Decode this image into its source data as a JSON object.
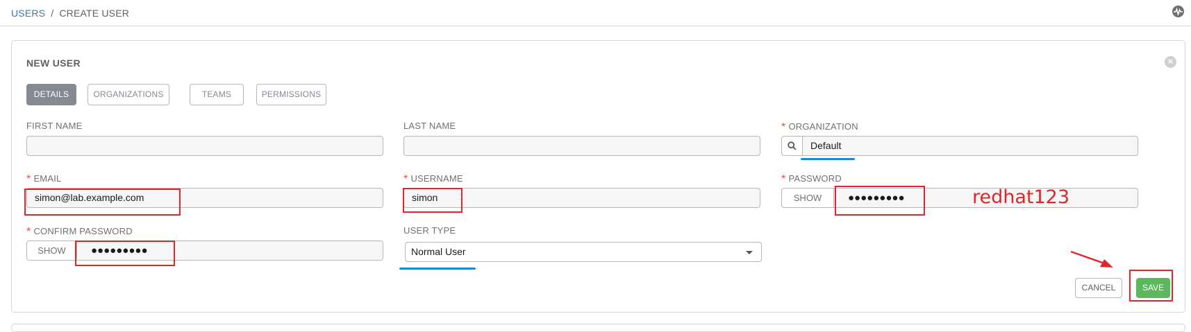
{
  "breadcrumb": {
    "users": "USERS",
    "separator": "/",
    "current": "CREATE USER"
  },
  "panel": {
    "title": "NEW USER",
    "close_icon": "close-icon"
  },
  "tabs": [
    {
      "label": "DETAILS",
      "active": true
    },
    {
      "label": "ORGANIZATIONS",
      "active": false
    },
    {
      "label": "TEAMS",
      "active": false
    },
    {
      "label": "PERMISSIONS",
      "active": false
    }
  ],
  "form": {
    "first_name": {
      "label": "FIRST NAME",
      "value": ""
    },
    "last_name": {
      "label": "LAST NAME",
      "value": ""
    },
    "organization": {
      "label": "ORGANIZATION",
      "value": "Default",
      "required": "*"
    },
    "email": {
      "label": "EMAIL",
      "value": "simon@lab.example.com",
      "required": "*"
    },
    "username": {
      "label": "USERNAME",
      "value": "simon",
      "required": "*"
    },
    "password": {
      "label": "PASSWORD",
      "show": "SHOW",
      "masked": "●●●●●●●●●",
      "required": "*"
    },
    "confirm_password": {
      "label": "CONFIRM PASSWORD",
      "show": "SHOW",
      "masked": "●●●●●●●●●",
      "required": "*"
    },
    "user_type": {
      "label": "USER TYPE",
      "value": "Normal User"
    }
  },
  "actions": {
    "cancel": "CANCEL",
    "save": "SAVE"
  },
  "annotations": {
    "password_hint": "redhat123"
  },
  "colors": {
    "link": "#337ab7",
    "save": "#5cb85c",
    "annotation_red": "#e0262b",
    "annotation_blue": "#1b8ad6"
  }
}
